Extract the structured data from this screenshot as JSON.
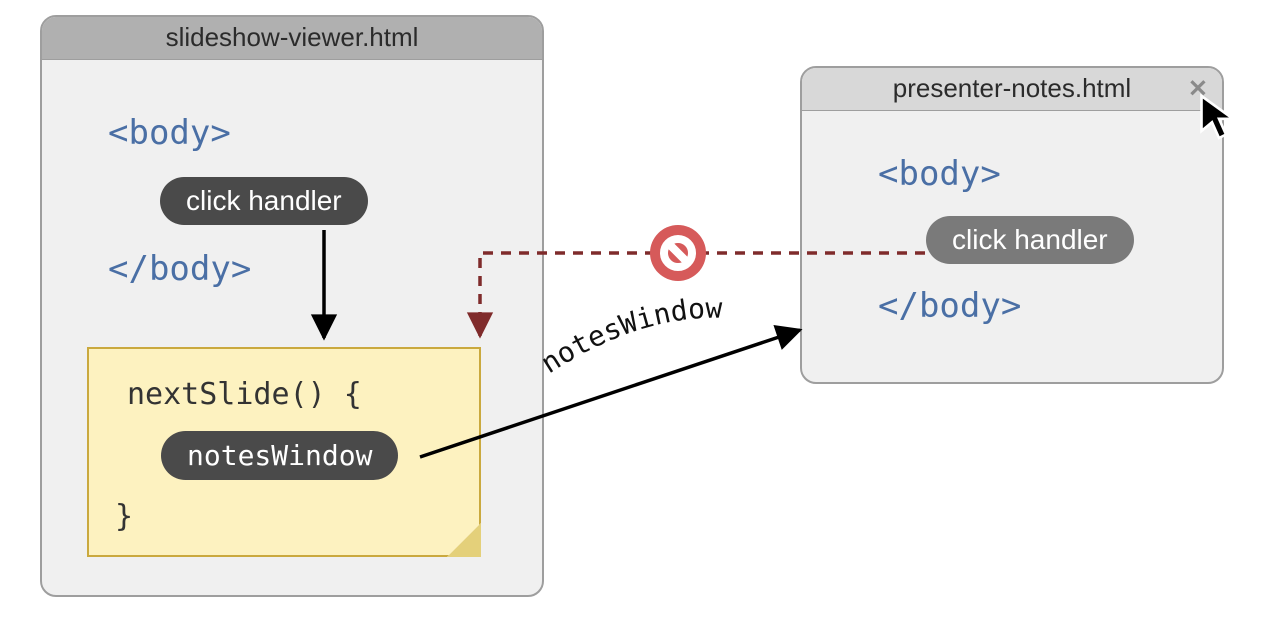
{
  "left_window": {
    "title": "slideshow-viewer.html",
    "body_open": "<body>",
    "body_close": "</body>",
    "click_handler_label": "click handler",
    "sticky": {
      "fn_open": "nextSlide() {",
      "var_pill": "notesWindow",
      "fn_close": "}"
    }
  },
  "right_window": {
    "title": "presenter-notes.html",
    "body_open": "<body>",
    "body_close": "</body>",
    "click_handler_label": "click handler",
    "close_glyph": "✕"
  },
  "arrow_label": "notesWindow",
  "colors": {
    "tag_blue": "#4a6fa5",
    "pill_dark": "#4a4a4a",
    "sticky_bg": "#fdf2c0",
    "sticky_border": "#caa93e",
    "dashed_red": "#7f2b2b",
    "no_symbol": "#d65a5a"
  }
}
